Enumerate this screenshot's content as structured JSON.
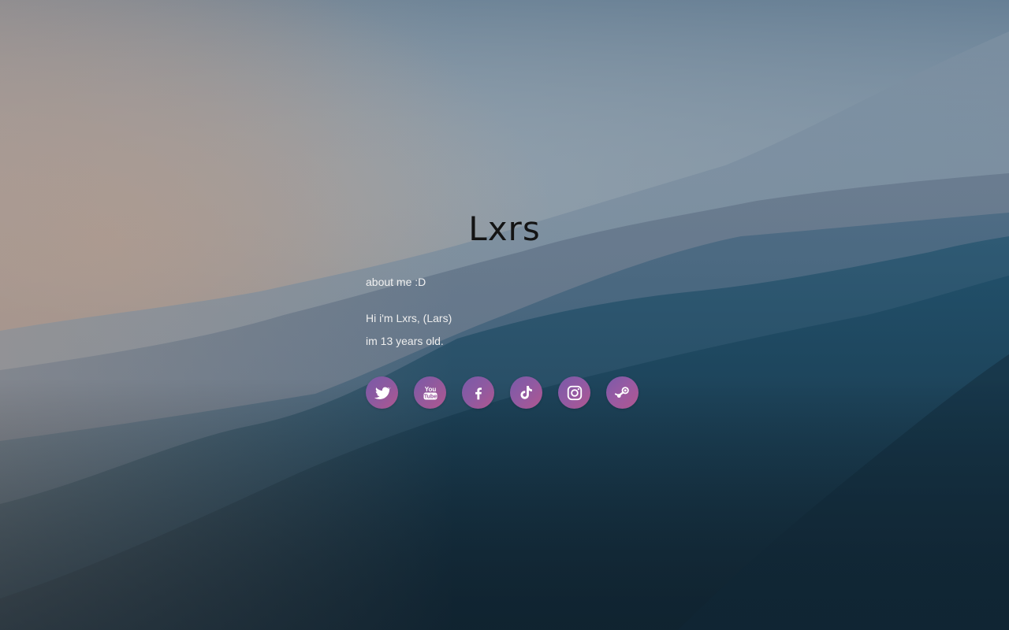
{
  "page": {
    "title": "Lxrs"
  },
  "about": {
    "heading": "about me :D",
    "lines": [
      "Hi i'm Lxrs, (Lars)",
      "im 13 years old."
    ]
  },
  "socials": [
    {
      "name": "twitter",
      "icon": "twitter-icon",
      "color": "#8e5a9f"
    },
    {
      "name": "youtube",
      "icon": "youtube-icon",
      "color": "#945a9c"
    },
    {
      "name": "facebook",
      "icon": "facebook-icon",
      "color": "#8e5aa1"
    },
    {
      "name": "tiktok",
      "icon": "tiktok-icon",
      "color": "#925aa1"
    },
    {
      "name": "instagram",
      "icon": "instagram-icon",
      "color": "#925aa3"
    },
    {
      "name": "steam",
      "icon": "steam-icon",
      "color": "#9a5aa2"
    }
  ],
  "theme": {
    "title_color": "#141414",
    "text_color": "#eeeeee",
    "icon_gradient_start": "#7a5aa8",
    "icon_gradient_end": "#b0568f"
  }
}
